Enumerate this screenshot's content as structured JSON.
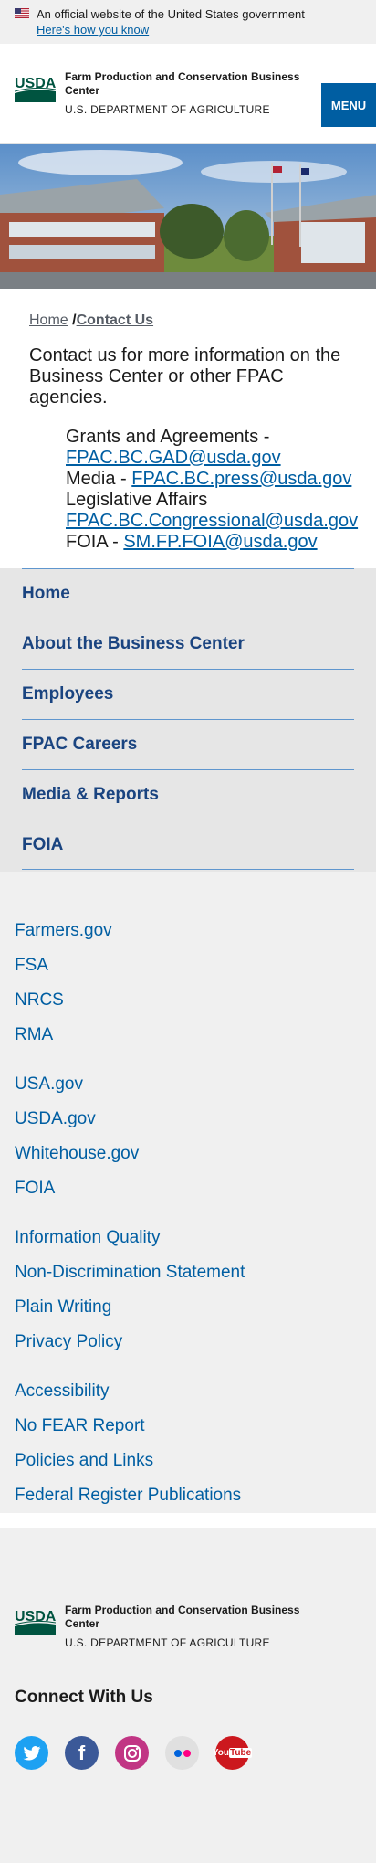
{
  "banner": {
    "official_text": "An official website of the United States government",
    "how_link": "Here's how you know"
  },
  "header": {
    "agency_name": "Farm Production and Conservation Business Center",
    "department": "U.S. DEPARTMENT OF AGRICULTURE",
    "menu_label": "MENU",
    "logo_text": "USDA"
  },
  "breadcrumb": {
    "home": "Home",
    "separator": "/",
    "current": "Contact Us"
  },
  "content": {
    "intro": "Contact us for more information on the Business Center or other FPAC agencies.",
    "contacts": [
      {
        "label": "Grants and Agreements - ",
        "email": "FPAC.BC.GAD@usda.gov"
      },
      {
        "label": "Media - ",
        "email": "FPAC.BC.press@usda.gov"
      },
      {
        "label": "Legislative Affairs ",
        "email": "FPAC.BC.Congressional@usda.gov"
      },
      {
        "label": "FOIA - ",
        "email": "SM.FP.FOIA@usda.gov"
      }
    ]
  },
  "sidenav": {
    "items": [
      "Home",
      "About the Business Center",
      "Employees",
      "FPAC Careers",
      "Media & Reports",
      "FOIA"
    ]
  },
  "footer": {
    "group1": [
      "Farmers.gov",
      "FSA",
      "NRCS",
      "RMA"
    ],
    "group2": [
      "USA.gov",
      "USDA.gov",
      "Whitehouse.gov",
      "FOIA"
    ],
    "group3": [
      "Information Quality",
      "Non-Discrimination Statement",
      "Plain Writing",
      "Privacy Policy"
    ],
    "group4": [
      "Accessibility",
      "No FEAR Report",
      "Policies and Links",
      "Federal Register Publications"
    ],
    "agency_name": "Farm Production and Conservation Business Center",
    "department": "U.S. DEPARTMENT OF AGRICULTURE",
    "connect": "Connect With Us",
    "social": [
      {
        "icon": "twitter-icon",
        "color": "#1da1f2",
        "glyph": "t"
      },
      {
        "icon": "facebook-icon",
        "color": "#3b5998",
        "glyph": "f"
      },
      {
        "icon": "instagram-icon",
        "color": "#c13584",
        "glyph": "◎"
      },
      {
        "icon": "flickr-icon",
        "color": "#e0e0e0",
        "glyph": "••"
      },
      {
        "icon": "youtube-icon",
        "color": "#cc181e",
        "glyph": "You"
      }
    ]
  },
  "colors": {
    "accent": "#005ea2",
    "nav_text": "#1a4480",
    "nav_bg": "#e6e6e6",
    "footer_bg": "#f0f0f0",
    "usda_green": "#005440"
  }
}
